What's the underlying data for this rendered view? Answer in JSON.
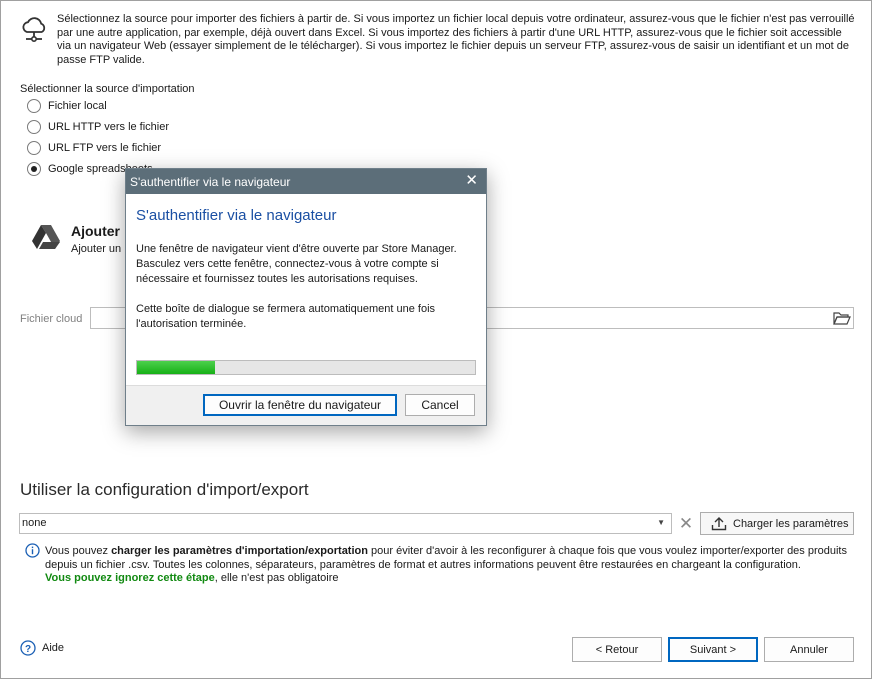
{
  "top_info": {
    "text": "Sélectionnez la source pour importer des fichiers à partir de. Si vous importez un fichier local depuis votre ordinateur, assurez-vous que le fichier n'est pas verrouillé par une autre application, par exemple, déjà ouvert dans Excel. Si vous importez des fichiers à partir d'une URL HTTP, assurez-vous que le fichier soit accessible via un navigateur Web (essayer simplement de le télécharger). Si vous importez le fichier depuis un serveur FTP, assurez-vous de saisir un identifiant et un mot de passe FTP valide.",
    "icon": "cloud-network-icon"
  },
  "source": {
    "label": "Sélectionner la source d'importation",
    "options": [
      {
        "label": "Fichier local",
        "checked": false
      },
      {
        "label": "URL HTTP vers le fichier",
        "checked": false
      },
      {
        "label": "URL FTP vers le fichier",
        "checked": false
      },
      {
        "label": "Google spreadsheets",
        "checked": true
      }
    ]
  },
  "add_section": {
    "title": "Ajouter",
    "subtitle": "Ajouter un",
    "icon": "google-drive-icon"
  },
  "cloud_file": {
    "label": "Fichier cloud",
    "value": "",
    "icon": "folder-open-icon"
  },
  "config": {
    "title": "Utiliser la configuration d'import/export",
    "selected": "none",
    "load_label": "Charger les paramètres"
  },
  "info": {
    "part1": "Vous pouvez ",
    "bold": "charger les paramètres d'importation/exportation",
    "part2": " pour éviter d'avoir à les reconfigurer à chaque fois que vous voulez importer/exporter des produits depuis un fichier .csv. Toutes les colonnes, séparateurs, paramètres de format et autres informations peuvent être restaurées en chargeant la configuration.",
    "green": "Vous pouvez ignorez cette étape",
    "part3": ", elle n'est pas obligatoire"
  },
  "footer": {
    "help": "Aide",
    "back": "< Retour",
    "next": "Suivant >",
    "cancel": "Annuler"
  },
  "modal": {
    "window_title": "S'authentifier via le navigateur",
    "heading": "S'authentifier via le navigateur",
    "paragraph1": "Une fenêtre de navigateur vient d'être ouverte par Store Manager. Basculez vers cette fenêtre, connectez-vous à votre compte si nécessaire et fournissez toutes les autorisations requises.",
    "paragraph2": "Cette boîte de dialogue se fermera automatiquement une fois l'autorisation terminée.",
    "progress": 0.23,
    "open_browser": "Ouvrir la fenêtre du navigateur",
    "cancel": "Cancel"
  }
}
